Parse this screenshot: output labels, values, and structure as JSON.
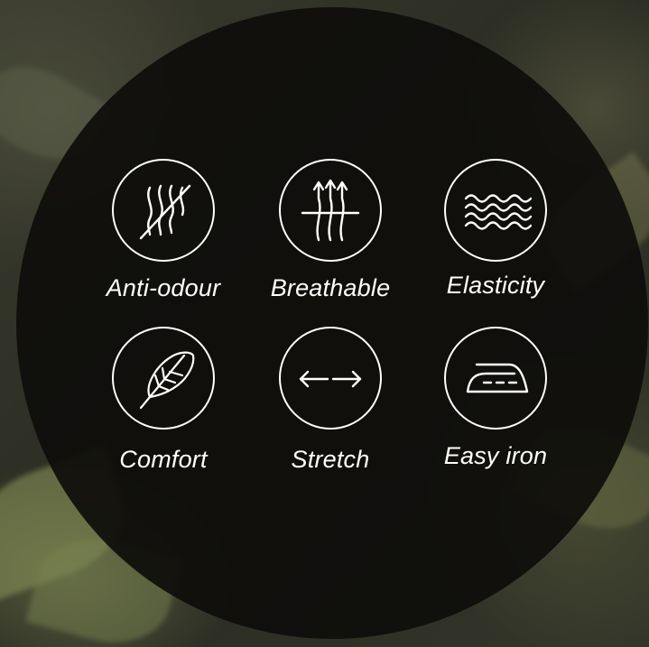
{
  "features": [
    {
      "label": "Anti-odour",
      "icon": "anti-odour-icon"
    },
    {
      "label": "Breathable",
      "icon": "breathable-icon"
    },
    {
      "label": "Elasticity",
      "icon": "elasticity-icon"
    },
    {
      "label": "Comfort",
      "icon": "feather-icon"
    },
    {
      "label": "Stretch",
      "icon": "stretch-arrows-icon"
    },
    {
      "label": "Easy iron",
      "icon": "iron-icon"
    }
  ],
  "colors": {
    "overlay": "#0e0d0b",
    "icon_stroke": "#ffffff",
    "text": "#ffffff"
  }
}
